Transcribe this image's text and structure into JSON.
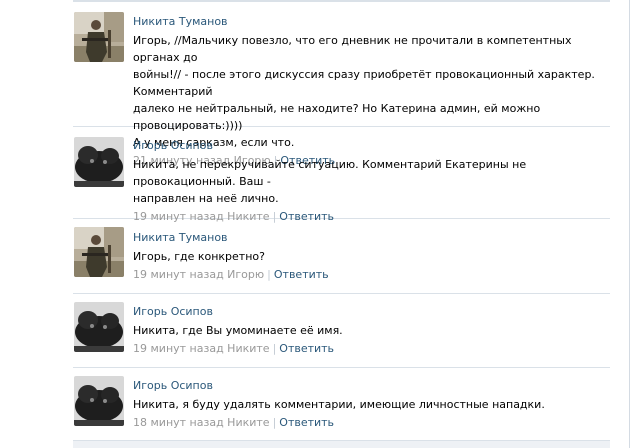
{
  "comments": [
    {
      "author": "Никита Туманов",
      "avatar": "soldier-photo",
      "lines": [
        "Игорь, //Мальчику повезло, что его дневник не прочитали в компетентных органах до",
        "войны!// - после этого дискуссия сразу приобретёт провокационный характер. Комментарий",
        "далеко не нейтральный, не находите? Но Катерина админ, ей можно провоцировать:))))",
        "А у меня сарказм, если что."
      ],
      "time": "21 минуту назад Игорю",
      "reply": "Ответить"
    },
    {
      "author": "Игорь Осипов",
      "avatar": "dark-rodent-photo",
      "lines": [
        "Никита, не перекручивайте ситуацию. Комментарий Екатерины не провокационный. Ваш -",
        "направлен на неё лично."
      ],
      "time": "19 минут назад Никите",
      "reply": "Ответить"
    },
    {
      "author": "Никита Туманов",
      "avatar": "soldier-photo",
      "lines": [
        "Игорь, где конкретно?"
      ],
      "time": "19 минут назад Игорю",
      "reply": "Ответить"
    },
    {
      "author": "Игорь Осипов",
      "avatar": "dark-rodent-photo",
      "lines": [
        "Никита, где Вы умоминаете её имя."
      ],
      "time": "19 минут назад Никите",
      "reply": "Ответить"
    },
    {
      "author": "Игорь Осипов",
      "avatar": "dark-rodent-photo",
      "lines": [
        "Никита, я буду удалять комментарии, имеющие личностные нападки."
      ],
      "time": "18 минут назад Никите",
      "reply": "Ответить"
    }
  ],
  "colors": {
    "link": "#2b587a",
    "meta": "#999999",
    "divider": "#dae1e8"
  }
}
